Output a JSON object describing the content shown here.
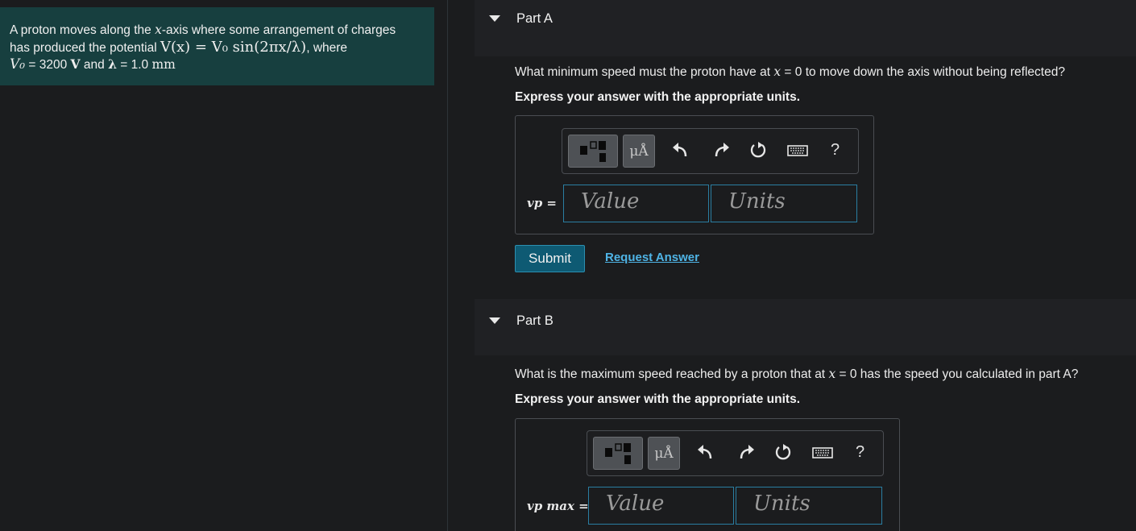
{
  "problem": {
    "line1_a": "A proton moves along the ",
    "line1_var": "x",
    "line1_b": "-axis where some arrangement of charges",
    "line2_a": "has produced the potential ",
    "formula": "V(x) = V₀ sin(2πx/λ)",
    "line2_b": ", where",
    "v0_sym": "V₀",
    "v0_value": " = 3200 ",
    "v0_unit": "V",
    "and_text": " and ",
    "lambda_sym": "λ",
    "lambda_value": " = 1.0 ",
    "lambda_unit": "mm"
  },
  "partA": {
    "title": "Part A",
    "question_a": "What minimum speed must the proton have at ",
    "question_var": "x",
    "question_b": " = 0 to move down the axis without being reflected?",
    "instruction": "Express your answer with the appropriate units.",
    "var_label": "vp =",
    "value_placeholder": "Value",
    "units_placeholder": "Units",
    "submit_label": "Submit",
    "request_label": "Request Answer"
  },
  "partB": {
    "title": "Part B",
    "question_a": "What is the maximum speed reached by a proton that at ",
    "question_var": "x",
    "question_b": " = 0 has the speed you calculated in part A?",
    "instruction": "Express your answer with the appropriate units.",
    "var_label": "vp max =",
    "value_placeholder": "Value",
    "units_placeholder": "Units"
  },
  "toolbar": {
    "units_btn": "μÅ",
    "help": "?"
  },
  "colors": {
    "problem_bg": "#173f3f",
    "accent": "#2a7ea2",
    "submit_bg": "#0e5a73",
    "link": "#4fb4e6"
  }
}
